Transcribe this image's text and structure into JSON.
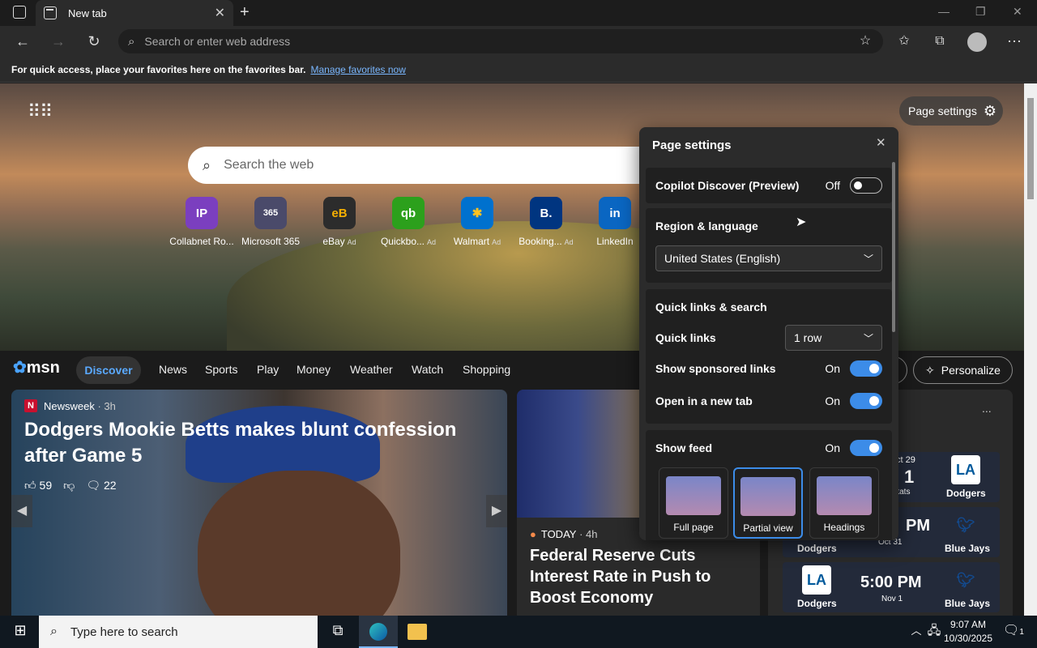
{
  "browser": {
    "tab_title": "New tab",
    "new_tab_symbol": "+",
    "address_placeholder": "Search or enter web address",
    "favorites_message": "For quick access, place your favorites here on the favorites bar.",
    "favorites_link": "Manage favorites now"
  },
  "newtab": {
    "page_settings_label": "Page settings",
    "search_placeholder": "Search the web",
    "quick_links": [
      {
        "label": "Collabnet Ro...",
        "icon": "IP",
        "ad": "",
        "color": "#7b3fbf"
      },
      {
        "label": "Microsoft 365",
        "icon": "365",
        "ad": "",
        "color": "#4a4a6a"
      },
      {
        "label": "eBay",
        "icon": "eB",
        "ad": "Ad",
        "color": "#2c2c2c"
      },
      {
        "label": "Quickbo...",
        "icon": "qb",
        "ad": "Ad",
        "color": "#2ca01c"
      },
      {
        "label": "Walmart",
        "icon": "✱",
        "ad": "Ad",
        "color": "#0071ce"
      },
      {
        "label": "Booking...",
        "icon": "B.",
        "ad": "Ad",
        "color": "#003580"
      },
      {
        "label": "LinkedIn",
        "icon": "in",
        "ad": "",
        "color": "#0a66c2"
      }
    ]
  },
  "msn": {
    "logo": "msn",
    "discover": "Discover",
    "nav": [
      "News",
      "Sports",
      "Play",
      "Money",
      "Weather",
      "Watch",
      "Shopping"
    ],
    "personalize": "Personalize",
    "story1": {
      "source": "Newsweek",
      "source_badge": "N",
      "age": "· 3h",
      "headline": "Dodgers Mookie Betts makes blunt confession after Game 5",
      "likes": "59",
      "comments": "22"
    },
    "story2": {
      "source": "TODAY",
      "age": "· 4h",
      "headline": "Federal Reserve Cuts Interest Rate in Push to Boost Economy"
    },
    "scores": [
      {
        "left_team": "",
        "left_top": "ct 29",
        "center": "1",
        "center_sub": "e stats",
        "right_team": "Dodgers"
      },
      {
        "left_team": "Dodgers",
        "center": "PM",
        "center_sub": "Oct 31",
        "right_team": "Blue Jays"
      },
      {
        "left_team": "Dodgers",
        "center": "5:00 PM",
        "center_sub": "Nov 1",
        "right_team": "Blue Jays"
      }
    ],
    "more": "..."
  },
  "panel": {
    "title": "Page settings",
    "copilot_label": "Copilot Discover (Preview)",
    "copilot_state": "Off",
    "region_header": "Region & language",
    "region_value": "United States (English)",
    "quicklinks_header": "Quick links & search",
    "quicklinks_label": "Quick links",
    "quicklinks_value": "1 row",
    "sponsored_label": "Show sponsored links",
    "sponsored_state": "On",
    "newtab_label": "Open in a new tab",
    "newtab_state": "On",
    "feed_label": "Show feed",
    "feed_state": "On",
    "layouts": [
      "Full page",
      "Partial view",
      "Headings"
    ],
    "selected_layout": "Partial view"
  },
  "taskbar": {
    "search_placeholder": "Type here to search",
    "time": "9:07 AM",
    "date": "10/30/2025",
    "notifications": "1"
  }
}
